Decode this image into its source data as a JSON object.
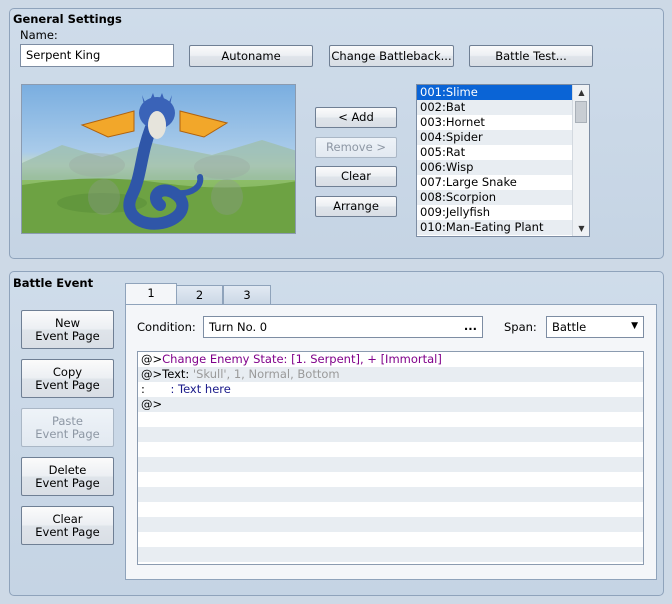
{
  "general": {
    "title": "General Settings",
    "name_label": "Name:",
    "name_value": "Serpent King",
    "autoname_label": "Autoname",
    "change_battleback_label": "Change Battleback...",
    "battle_test_label": "Battle Test...",
    "add_label": "< Add",
    "remove_label": "Remove >",
    "clear_label": "Clear",
    "arrange_label": "Arrange",
    "enemies": [
      "001:Slime",
      "002:Bat",
      "003:Hornet",
      "004:Spider",
      "005:Rat",
      "006:Wisp",
      "007:Large Snake",
      "008:Scorpion",
      "009:Jellyfish",
      "010:Man-Eating Plant"
    ],
    "selected_index": 0
  },
  "battle_event": {
    "title": "Battle Event",
    "new_page": [
      "New",
      "Event Page"
    ],
    "copy_page": [
      "Copy",
      "Event Page"
    ],
    "paste_page": [
      "Paste",
      "Event Page"
    ],
    "delete_page": [
      "Delete",
      "Event Page"
    ],
    "clear_page": [
      "Clear",
      "Event Page"
    ],
    "tabs": [
      "1",
      "2",
      "3"
    ],
    "active_tab": 0,
    "condition_label": "Condition:",
    "condition_value": "Turn No. 0",
    "condition_button": "...",
    "span_label": "Span:",
    "span_value": "Battle",
    "commands": {
      "line1_prefix": "@>",
      "line1_text": "Change Enemy State: [1. Serpent], + [Immortal]",
      "line2_prefix": "@>Text:",
      "line2_params": " 'Skull', 1, Normal, Bottom",
      "line3_prefix": " :",
      "line3_text": "       : Text here",
      "line4_prefix": "@>"
    }
  },
  "colors": {
    "selection": "#0a64d6",
    "command_purple": "#80008a",
    "param_gray": "#9a9a9a"
  }
}
